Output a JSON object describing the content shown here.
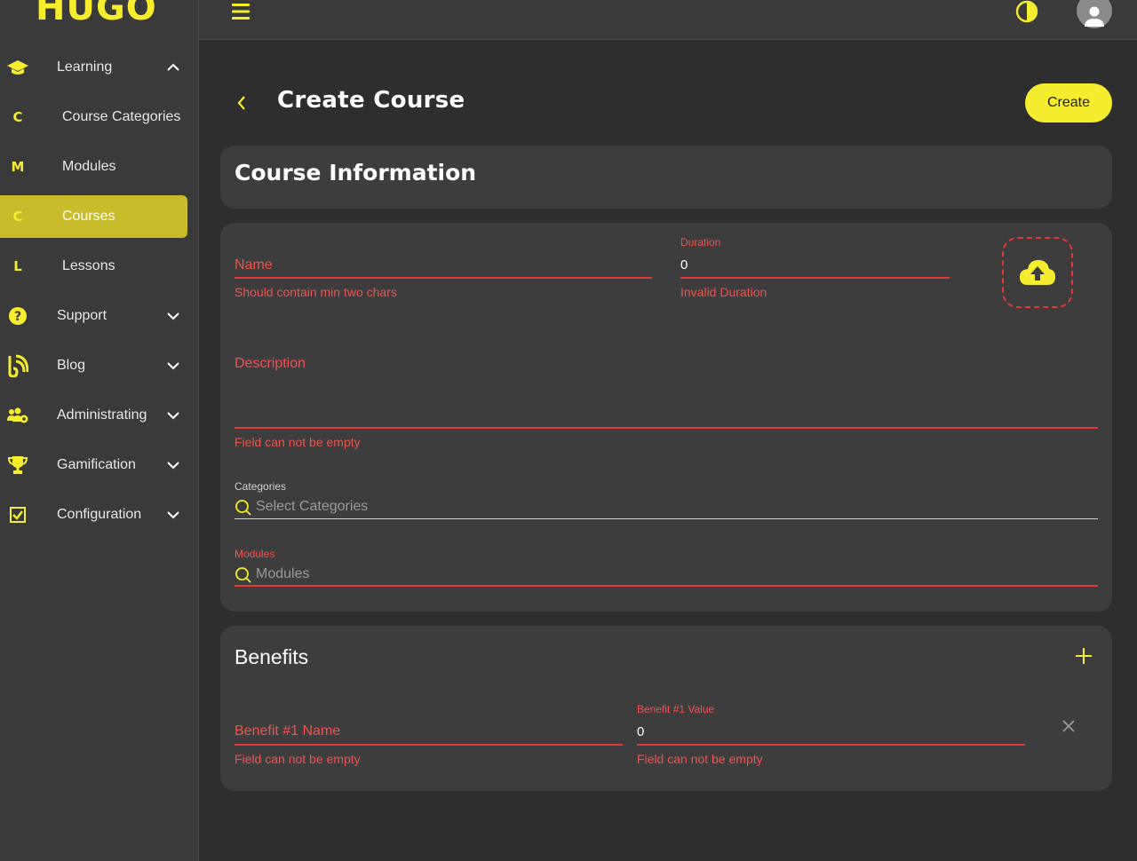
{
  "app": {
    "logo": "HUGO"
  },
  "sidebar": {
    "items": [
      {
        "icon": "graduation-cap-icon",
        "label": "Learning",
        "expanded": true
      },
      {
        "badge": "C",
        "label": "Course Categories"
      },
      {
        "badge": "M",
        "label": "Modules"
      },
      {
        "badge": "C",
        "label": "Courses",
        "active": true
      },
      {
        "badge": "L",
        "label": "Lessons"
      },
      {
        "icon": "help-circle-icon",
        "label": "Support"
      },
      {
        "icon": "blog-rss-icon",
        "label": "Blog"
      },
      {
        "icon": "users-gear-icon",
        "label": "Administrating"
      },
      {
        "icon": "trophy-icon",
        "label": "Gamification"
      },
      {
        "icon": "check-square-icon",
        "label": "Configuration"
      }
    ]
  },
  "header": {
    "title": "Create Course",
    "create_label": "Create"
  },
  "course_info": {
    "title": "Course Information"
  },
  "form": {
    "name": {
      "placeholder": "Name",
      "error": "Should contain min two chars"
    },
    "duration": {
      "label": "Duration",
      "value": "0",
      "error": "Invalid Duration"
    },
    "description": {
      "placeholder": "Description",
      "error": "Field can not be empty"
    },
    "categories": {
      "label": "Categories",
      "placeholder": "Select Categories"
    },
    "modules": {
      "label": "Modules",
      "placeholder": "Modules"
    }
  },
  "benefits": {
    "title": "Benefits",
    "items": [
      {
        "name_placeholder": "Benefit #1 Name",
        "name_error": "Field can not be empty",
        "value_label": "Benefit #1 Value",
        "value": "0",
        "value_error": "Field can not be empty"
      }
    ]
  },
  "colors": {
    "accent": "#f5ed2e",
    "error": "#e53935",
    "background": "#2e2e2e",
    "card": "#3d3d3d"
  }
}
